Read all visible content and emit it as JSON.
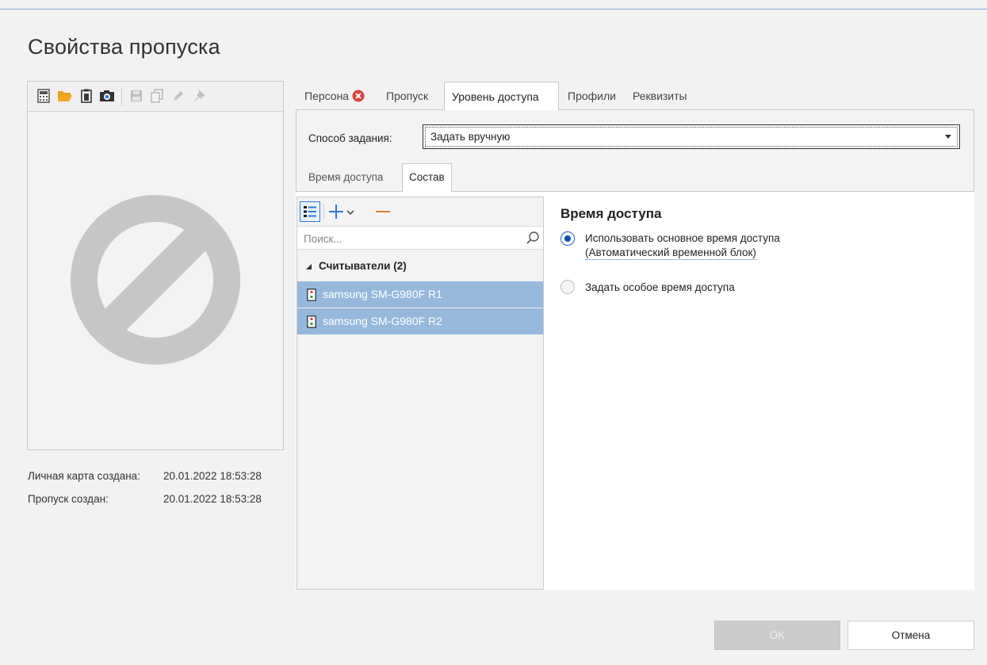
{
  "dialog": {
    "title": "Свойства пропуска"
  },
  "photo_toolbar": {
    "icons": [
      "calculator-icon",
      "folder-open-icon",
      "clipboard-icon",
      "camera-icon",
      "save-icon",
      "copy-icon",
      "pencil-icon",
      "pin-icon"
    ]
  },
  "info": {
    "card_created_label": "Личная карта создана:",
    "card_created_value": "20.01.2022 18:53:28",
    "pass_created_label": "Пропуск создан:",
    "pass_created_value": "20.01.2022 18:53:28"
  },
  "tabs": [
    {
      "label": "Персона",
      "has_error": true
    },
    {
      "label": "Пропуск"
    },
    {
      "label": "Уровень доступа",
      "active": true
    },
    {
      "label": "Профили"
    },
    {
      "label": "Реквизиты"
    }
  ],
  "access_level": {
    "method_label": "Способ задания:",
    "method_value": "Задать вручную",
    "subtabs": [
      {
        "label": "Время доступа"
      },
      {
        "label": "Состав",
        "active": true
      }
    ],
    "search_placeholder": "Поиск...",
    "group_label": "Считыватели (2)",
    "readers": [
      "samsung SM-G980F R1",
      "samsung SM-G980F R2"
    ],
    "section_title": "Время доступа",
    "option_default_line1": "Использовать основное время доступа",
    "option_default_line2": "(Автоматический временной блок)",
    "option_custom": "Задать особое время доступа",
    "selected_option": "default"
  },
  "buttons": {
    "ok": "OK",
    "cancel": "Отмена"
  },
  "colors": {
    "selection": "#96b8dc",
    "accent_blue": "#2a7ad6",
    "accent_orange": "#e0802a",
    "error_red": "#d9453d"
  }
}
